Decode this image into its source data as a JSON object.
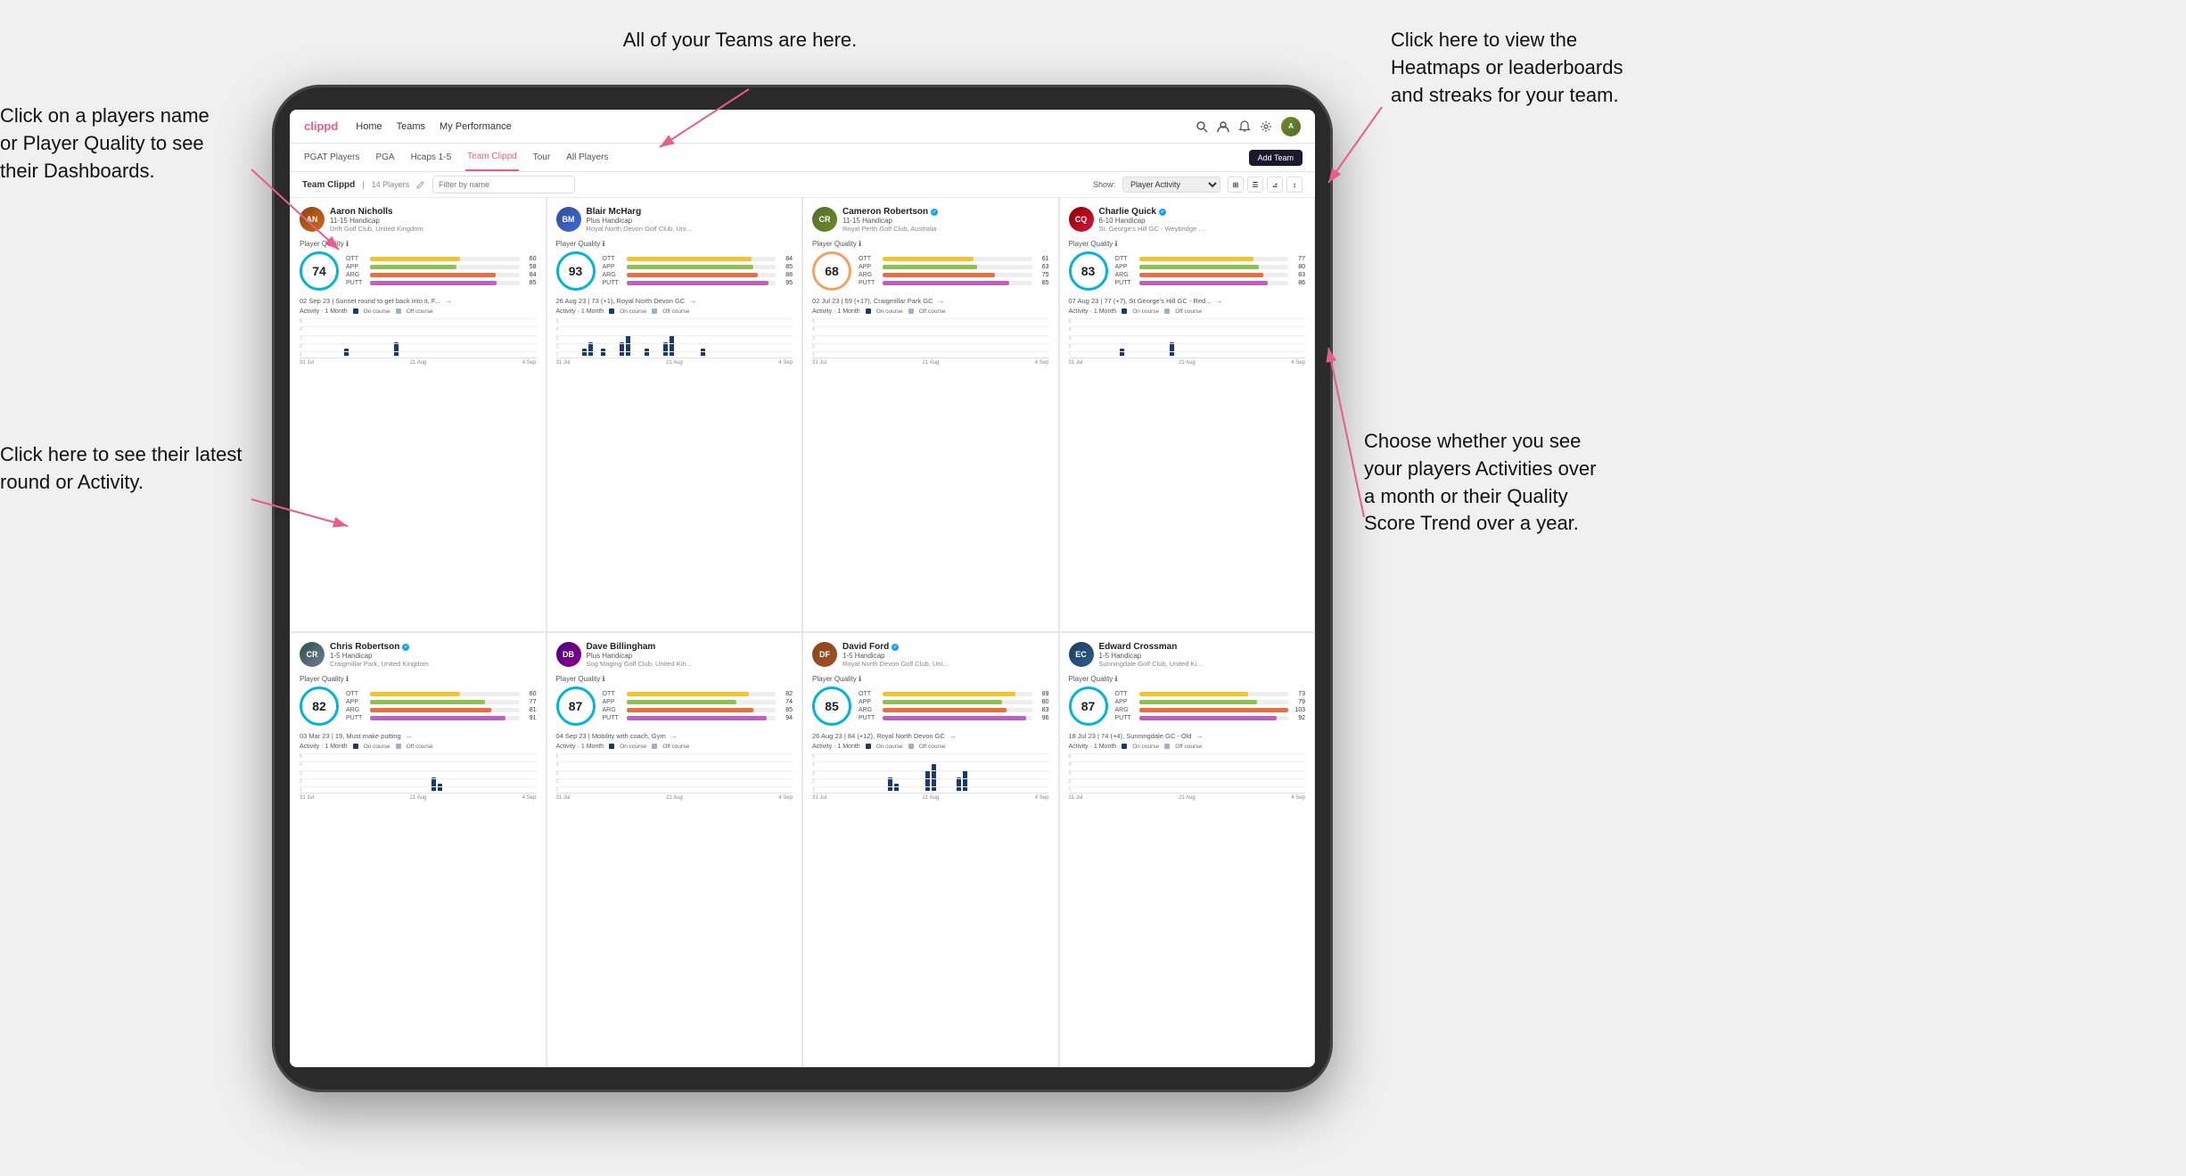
{
  "annotations": {
    "left1": "Click on a players name\nor Player Quality to see\ntheir Dashboards.",
    "left2": "Click here to see their latest\nround or Activity.",
    "top": "All of your Teams are here.",
    "right1": "Click here to view the\nHeatmaps or leaderboards\nand streaks for your team.",
    "right2": "Choose whether you see\nyour players Activities over\na month or their Quality\nScore Trend over a year."
  },
  "nav": {
    "logo": "clippd",
    "links": [
      "Home",
      "Teams",
      "My Performance"
    ],
    "addTeam": "Add Team"
  },
  "tabs": {
    "items": [
      "PGAT Players",
      "PGA",
      "Hcaps 1-5",
      "Team Clippd",
      "Tour",
      "All Players"
    ]
  },
  "teamHeader": {
    "title": "Team Clippd",
    "count": "14 Players",
    "searchPlaceholder": "Filter by name",
    "showLabel": "Show:",
    "showValue": "Player Activity"
  },
  "players": [
    {
      "name": "Aaron Nicholls",
      "handicap": "11-15 Handicap",
      "club": "Drift Golf Club, United Kingdom",
      "quality": 74,
      "qualityClass": "q74",
      "stats": {
        "ott": {
          "label": "OTT",
          "value": 60,
          "pct": 60
        },
        "app": {
          "label": "APP",
          "value": 58,
          "pct": 58
        },
        "arg": {
          "label": "ARG",
          "value": 84,
          "pct": 84
        },
        "putt": {
          "label": "PUTT",
          "value": 85,
          "pct": 85
        }
      },
      "latestRound": "02 Sep 23 | Sunset round to get back into it, F...",
      "activity": {
        "label": "Activity · 1 Month",
        "bars": [
          0,
          0,
          0,
          0,
          0,
          0,
          1,
          0,
          0,
          0,
          0,
          0,
          0,
          0,
          2,
          0,
          0,
          0,
          0,
          0,
          0,
          0,
          0,
          0,
          0,
          0,
          0,
          0
        ]
      },
      "dates": [
        "31 Jul",
        "21 Aug",
        "4 Sep"
      ],
      "verified": false,
      "avatarClass": "av-aaron",
      "initials": "AN"
    },
    {
      "name": "Blair McHarg",
      "handicap": "Plus Handicap",
      "club": "Royal North Devon Golf Club, United Kin...",
      "quality": 93,
      "qualityClass": "q93",
      "stats": {
        "ott": {
          "label": "OTT",
          "value": 84,
          "pct": 84
        },
        "app": {
          "label": "APP",
          "value": 85,
          "pct": 85
        },
        "arg": {
          "label": "ARG",
          "value": 88,
          "pct": 88
        },
        "putt": {
          "label": "PUTT",
          "value": 95,
          "pct": 95
        }
      },
      "latestRound": "26 Aug 23 | 73 (+1), Royal North Devon GC",
      "activity": {
        "label": "Activity · 1 Month",
        "bars": [
          0,
          0,
          0,
          1,
          2,
          0,
          1,
          0,
          0,
          2,
          3,
          0,
          0,
          1,
          0,
          0,
          2,
          3,
          0,
          0,
          0,
          0,
          1,
          0,
          0,
          0,
          0,
          0
        ]
      },
      "dates": [
        "31 Jul",
        "21 Aug",
        "4 Sep"
      ],
      "verified": false,
      "avatarClass": "av-blair",
      "initials": "BM"
    },
    {
      "name": "Cameron Robertson",
      "handicap": "11-15 Handicap",
      "club": "Royal Perth Golf Club, Australia",
      "quality": 68,
      "qualityClass": "q68",
      "stats": {
        "ott": {
          "label": "OTT",
          "value": 61,
          "pct": 61
        },
        "app": {
          "label": "APP",
          "value": 63,
          "pct": 63
        },
        "arg": {
          "label": "ARG",
          "value": 75,
          "pct": 75
        },
        "putt": {
          "label": "PUTT",
          "value": 85,
          "pct": 85
        }
      },
      "latestRound": "02 Jul 23 | 59 (+17), Craigmillar Park GC",
      "activity": {
        "label": "Activity · 1 Month",
        "bars": [
          0,
          0,
          0,
          0,
          0,
          0,
          0,
          0,
          0,
          0,
          0,
          0,
          0,
          0,
          0,
          0,
          0,
          0,
          0,
          0,
          0,
          0,
          0,
          0,
          0,
          0,
          0,
          0
        ]
      },
      "dates": [
        "31 Jul",
        "21 Aug",
        "4 Sep"
      ],
      "verified": true,
      "avatarClass": "av-cameron",
      "initials": "CR"
    },
    {
      "name": "Charlie Quick",
      "handicap": "6-10 Handicap",
      "club": "St. George's Hill GC - Weybridge - Surrey...",
      "quality": 83,
      "qualityClass": "q83",
      "stats": {
        "ott": {
          "label": "OTT",
          "value": 77,
          "pct": 77
        },
        "app": {
          "label": "APP",
          "value": 80,
          "pct": 80
        },
        "arg": {
          "label": "ARG",
          "value": 83,
          "pct": 83
        },
        "putt": {
          "label": "PUTT",
          "value": 86,
          "pct": 86
        }
      },
      "latestRound": "07 Aug 23 | 77 (+7), St George's Hill GC - Red...",
      "activity": {
        "label": "Activity · 1 Month",
        "bars": [
          0,
          0,
          0,
          0,
          0,
          0,
          0,
          1,
          0,
          0,
          0,
          0,
          0,
          0,
          0,
          2,
          0,
          0,
          0,
          0,
          0,
          0,
          0,
          0,
          0,
          0,
          0,
          0
        ]
      },
      "dates": [
        "31 Jul",
        "21 Aug",
        "4 Sep"
      ],
      "verified": true,
      "avatarClass": "av-charlie",
      "initials": "CQ"
    },
    {
      "name": "Chris Robertson",
      "handicap": "1-5 Handicap",
      "club": "Craigmillar Park, United Kingdom",
      "quality": 82,
      "qualityClass": "q82",
      "stats": {
        "ott": {
          "label": "OTT",
          "value": 60,
          "pct": 60
        },
        "app": {
          "label": "APP",
          "value": 77,
          "pct": 77
        },
        "arg": {
          "label": "ARG",
          "value": 81,
          "pct": 81
        },
        "putt": {
          "label": "PUTT",
          "value": 91,
          "pct": 91
        }
      },
      "latestRound": "03 Mar 23 | 19, Must make putting",
      "activity": {
        "label": "Activity · 1 Month",
        "bars": [
          0,
          0,
          0,
          0,
          0,
          0,
          0,
          0,
          0,
          0,
          0,
          0,
          0,
          0,
          0,
          0,
          0,
          0,
          0,
          0,
          2,
          1,
          0,
          0,
          0,
          0,
          0,
          0
        ]
      },
      "dates": [
        "31 Jul",
        "21 Aug",
        "4 Sep"
      ],
      "verified": true,
      "avatarClass": "av-chris",
      "initials": "CR"
    },
    {
      "name": "Dave Billingham",
      "handicap": "Plus Handicap",
      "club": "Sog Maging Golf Club, United Kingdom",
      "quality": 87,
      "qualityClass": "q87",
      "stats": {
        "ott": {
          "label": "OTT",
          "value": 82,
          "pct": 82
        },
        "app": {
          "label": "APP",
          "value": 74,
          "pct": 74
        },
        "arg": {
          "label": "ARG",
          "value": 85,
          "pct": 85
        },
        "putt": {
          "label": "PUTT",
          "value": 94,
          "pct": 94
        }
      },
      "latestRound": "04 Sep 23 | Mobility with coach, Gym",
      "activity": {
        "label": "Activity · 1 Month",
        "bars": [
          0,
          0,
          0,
          0,
          0,
          0,
          0,
          0,
          0,
          0,
          0,
          0,
          0,
          0,
          0,
          0,
          0,
          0,
          0,
          0,
          0,
          0,
          0,
          0,
          0,
          0,
          0,
          0
        ]
      },
      "dates": [
        "31 Jul",
        "21 Aug",
        "4 Sep"
      ],
      "verified": false,
      "avatarClass": "av-dave",
      "initials": "DB"
    },
    {
      "name": "David Ford",
      "handicap": "1-5 Handicap",
      "club": "Royal North Devon Golf Club, United Kin...",
      "quality": 85,
      "qualityClass": "q85",
      "stats": {
        "ott": {
          "label": "OTT",
          "value": 89,
          "pct": 89
        },
        "app": {
          "label": "APP",
          "value": 80,
          "pct": 80
        },
        "arg": {
          "label": "ARG",
          "value": 83,
          "pct": 83
        },
        "putt": {
          "label": "PUTT",
          "value": 96,
          "pct": 96
        }
      },
      "latestRound": "26 Aug 23 | 84 (+12), Royal North Devon GC",
      "activity": {
        "label": "Activity · 1 Month",
        "bars": [
          0,
          0,
          0,
          0,
          0,
          0,
          0,
          0,
          0,
          0,
          0,
          2,
          1,
          0,
          0,
          0,
          0,
          3,
          4,
          0,
          0,
          0,
          2,
          3,
          0,
          0,
          0,
          0
        ]
      },
      "dates": [
        "31 Jul",
        "21 Aug",
        "4 Sep"
      ],
      "verified": true,
      "avatarClass": "av-david",
      "initials": "DF"
    },
    {
      "name": "Edward Crossman",
      "handicap": "1-5 Handicap",
      "club": "Sunningdale Golf Club, United Kingdom",
      "quality": 87,
      "qualityClass": "q87b",
      "stats": {
        "ott": {
          "label": "OTT",
          "value": 73,
          "pct": 73
        },
        "app": {
          "label": "APP",
          "value": 79,
          "pct": 79
        },
        "arg": {
          "label": "ARG",
          "value": 103,
          "pct": 100
        },
        "putt": {
          "label": "PUTT",
          "value": 92,
          "pct": 92
        }
      },
      "latestRound": "18 Jul 23 | 74 (+4), Sunningdale GC - Old",
      "activity": {
        "label": "Activity · 1 Month",
        "bars": [
          0,
          0,
          0,
          0,
          0,
          0,
          0,
          0,
          0,
          0,
          0,
          0,
          0,
          0,
          0,
          0,
          0,
          0,
          0,
          0,
          0,
          0,
          0,
          0,
          0,
          0,
          0,
          0
        ]
      },
      "dates": [
        "31 Jul",
        "21 Aug",
        "4 Sep"
      ],
      "verified": false,
      "avatarClass": "av-edward",
      "initials": "EC"
    }
  ]
}
